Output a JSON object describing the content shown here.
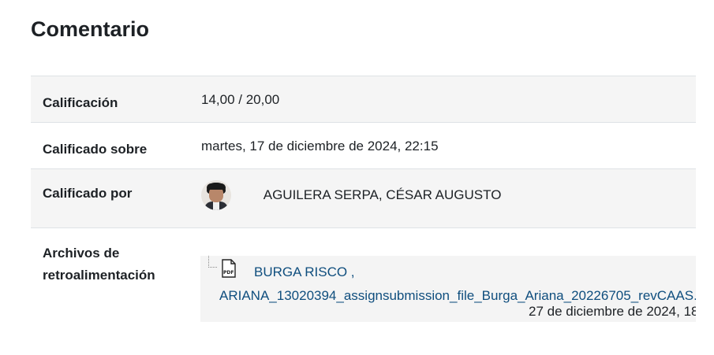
{
  "section": {
    "title": "Comentario"
  },
  "rows": [
    {
      "label": "Calificación",
      "value": "14,00 / 20,00"
    },
    {
      "label": "Calificado sobre",
      "value": "martes, 17 de diciembre de 2024, 22:15"
    },
    {
      "label": "Calificado por",
      "value": "AGUILERA SERPA, CÉSAR AUGUSTO"
    },
    {
      "label": "Archivos de retroalimentación"
    }
  ],
  "feedback_file": {
    "name_line1": "BURGA RISCO ,",
    "name_line2": "ARIANA_13020394_assignsubmission_file_Burga_Ariana_20226705_revCAAS.",
    "date": "27 de diciembre de 2024, 18",
    "icon": "pdf-file-icon",
    "icon_label": "PDF"
  },
  "colors": {
    "link": "#0f4e7e",
    "row_shade": "#f5f5f5",
    "border": "#dee2e6"
  }
}
